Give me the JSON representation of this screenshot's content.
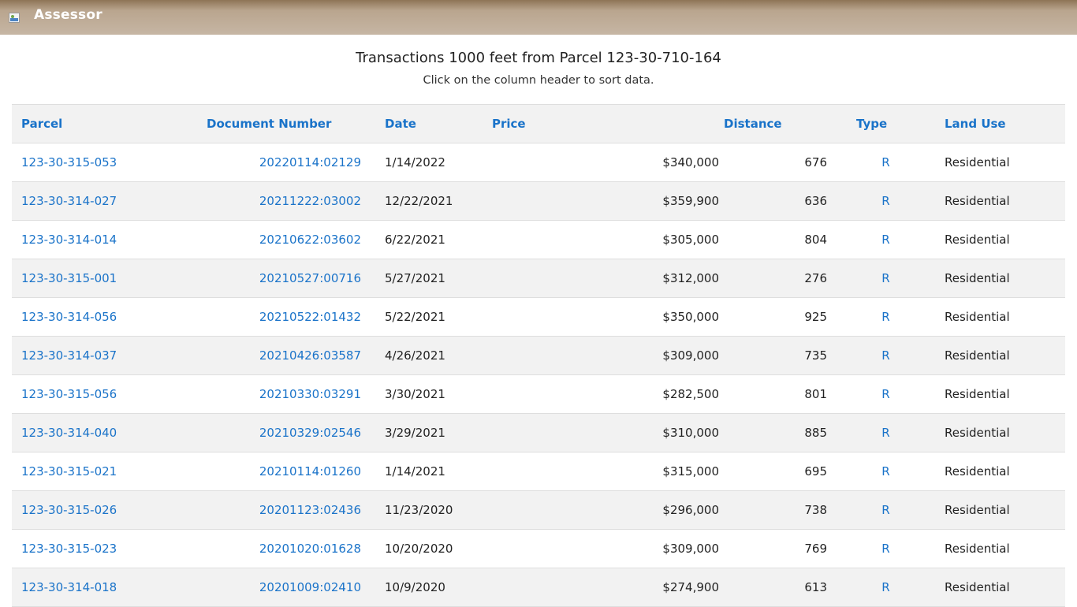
{
  "header": {
    "brand": "Assessor"
  },
  "page": {
    "title": "Transactions 1000 feet from Parcel 123-30-710-164",
    "subtitle": "Click on the column header to sort data."
  },
  "table": {
    "headers": {
      "parcel": "Parcel",
      "document_number": "Document Number",
      "date": "Date",
      "price": "Price",
      "distance": "Distance",
      "type": "Type",
      "land_use": "Land Use"
    },
    "rows": [
      {
        "parcel": "123-30-315-053",
        "document_number": "20220114:02129",
        "date": "1/14/2022",
        "price": "$340,000",
        "distance": "676",
        "type": "R",
        "land_use": "Residential"
      },
      {
        "parcel": "123-30-314-027",
        "document_number": "20211222:03002",
        "date": "12/22/2021",
        "price": "$359,900",
        "distance": "636",
        "type": "R",
        "land_use": "Residential"
      },
      {
        "parcel": "123-30-314-014",
        "document_number": "20210622:03602",
        "date": "6/22/2021",
        "price": "$305,000",
        "distance": "804",
        "type": "R",
        "land_use": "Residential"
      },
      {
        "parcel": "123-30-315-001",
        "document_number": "20210527:00716",
        "date": "5/27/2021",
        "price": "$312,000",
        "distance": "276",
        "type": "R",
        "land_use": "Residential"
      },
      {
        "parcel": "123-30-314-056",
        "document_number": "20210522:01432",
        "date": "5/22/2021",
        "price": "$350,000",
        "distance": "925",
        "type": "R",
        "land_use": "Residential"
      },
      {
        "parcel": "123-30-314-037",
        "document_number": "20210426:03587",
        "date": "4/26/2021",
        "price": "$309,000",
        "distance": "735",
        "type": "R",
        "land_use": "Residential"
      },
      {
        "parcel": "123-30-315-056",
        "document_number": "20210330:03291",
        "date": "3/30/2021",
        "price": "$282,500",
        "distance": "801",
        "type": "R",
        "land_use": "Residential"
      },
      {
        "parcel": "123-30-314-040",
        "document_number": "20210329:02546",
        "date": "3/29/2021",
        "price": "$310,000",
        "distance": "885",
        "type": "R",
        "land_use": "Residential"
      },
      {
        "parcel": "123-30-315-021",
        "document_number": "20210114:01260",
        "date": "1/14/2021",
        "price": "$315,000",
        "distance": "695",
        "type": "R",
        "land_use": "Residential"
      },
      {
        "parcel": "123-30-315-026",
        "document_number": "20201123:02436",
        "date": "11/23/2020",
        "price": "$296,000",
        "distance": "738",
        "type": "R",
        "land_use": "Residential"
      },
      {
        "parcel": "123-30-315-023",
        "document_number": "20201020:01628",
        "date": "10/20/2020",
        "price": "$309,000",
        "distance": "769",
        "type": "R",
        "land_use": "Residential"
      },
      {
        "parcel": "123-30-314-018",
        "document_number": "20201009:02410",
        "date": "10/9/2020",
        "price": "$274,900",
        "distance": "613",
        "type": "R",
        "land_use": "Residential"
      }
    ]
  },
  "colors": {
    "link": "#1a73c9",
    "header_bar": "#c6b6a4",
    "row_alt": "#f2f2f2"
  }
}
